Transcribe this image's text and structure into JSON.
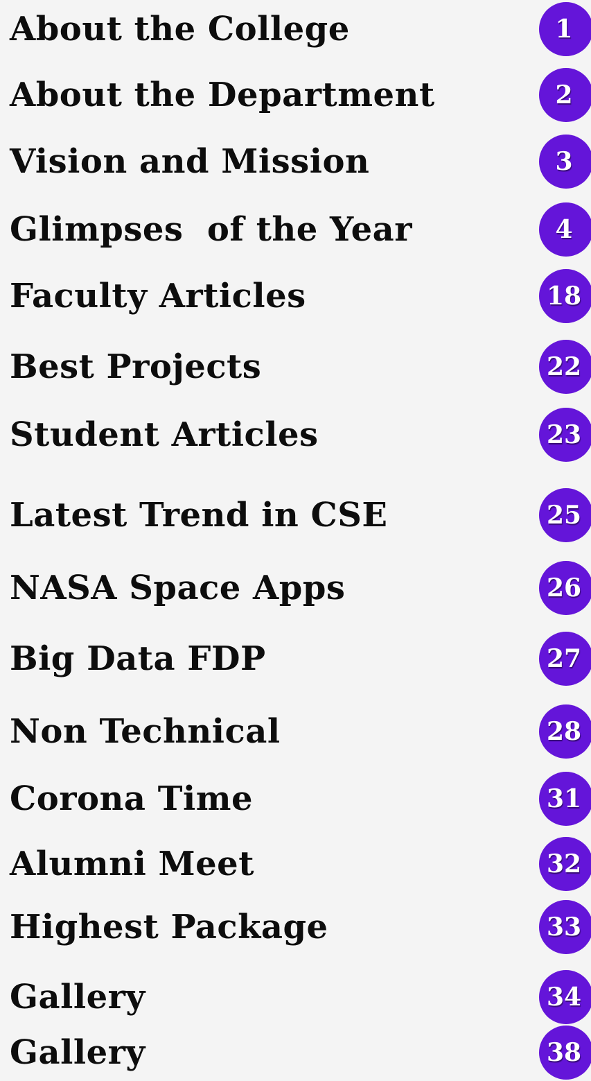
{
  "toc": {
    "items": [
      {
        "title": "About the College",
        "page": "1"
      },
      {
        "title": "About the Department",
        "page": "2"
      },
      {
        "title": "Vision and Mission",
        "page": "3"
      },
      {
        "title": "Glimpses  of the Year",
        "page": "4"
      },
      {
        "title": "Faculty Articles",
        "page": "18"
      },
      {
        "title": "Best Projects",
        "page": "22"
      },
      {
        "title": "Student Articles",
        "page": "23"
      },
      {
        "title": "Latest Trend in CSE",
        "page": "25"
      },
      {
        "title": "NASA Space Apps",
        "page": "26"
      },
      {
        "title": "Big Data FDP",
        "page": "27"
      },
      {
        "title": "Non Technical",
        "page": "28"
      },
      {
        "title": "Corona Time",
        "page": "31"
      },
      {
        "title": "Alumni Meet",
        "page": "32"
      },
      {
        "title": "Highest Package",
        "page": "33"
      },
      {
        "title": "Gallery",
        "page": "34"
      },
      {
        "title": "Gallery",
        "page": "38"
      }
    ]
  },
  "colors": {
    "background": "#f4f4f4",
    "text": "#0d0d0d",
    "badge": "#6415d9",
    "badge_text": "#ffffff"
  }
}
